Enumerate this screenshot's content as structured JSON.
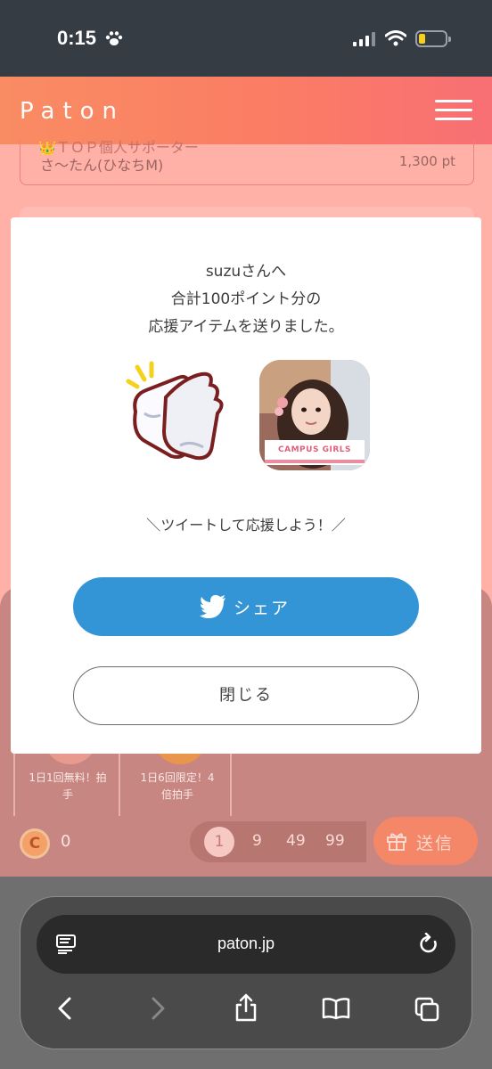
{
  "status": {
    "time": "0:15"
  },
  "header": {
    "logo": "Paton"
  },
  "supporter": {
    "label": "👑ＴＯＰ個人サポーター",
    "name": "さ〜たん(ひなちM)",
    "points": "1,300 pt"
  },
  "modal": {
    "line1": "suzuさんへ",
    "line2": "合計100ポイント分の",
    "line3": "応援アイテムを送りました。",
    "photo_caption": "CAMPUS GIRLS",
    "tweet_prompt": "＼ツイートして応援しよう！／",
    "share_label": "シェア",
    "close_label": "閉じる"
  },
  "items": [
    {
      "line1": "1日1回無料！拍",
      "line2": "手"
    },
    {
      "line1": "1日6回限定！4",
      "line2": "倍拍手"
    }
  ],
  "coin": {
    "symbol": "C",
    "balance": "0"
  },
  "counts": [
    "1",
    "9",
    "49",
    "99"
  ],
  "send_label": "送信",
  "browser": {
    "url": "paton.jp"
  },
  "colors": {
    "header": "#fb7d64",
    "share": "#3495d6",
    "overlay_page": "#ffb1a8"
  }
}
